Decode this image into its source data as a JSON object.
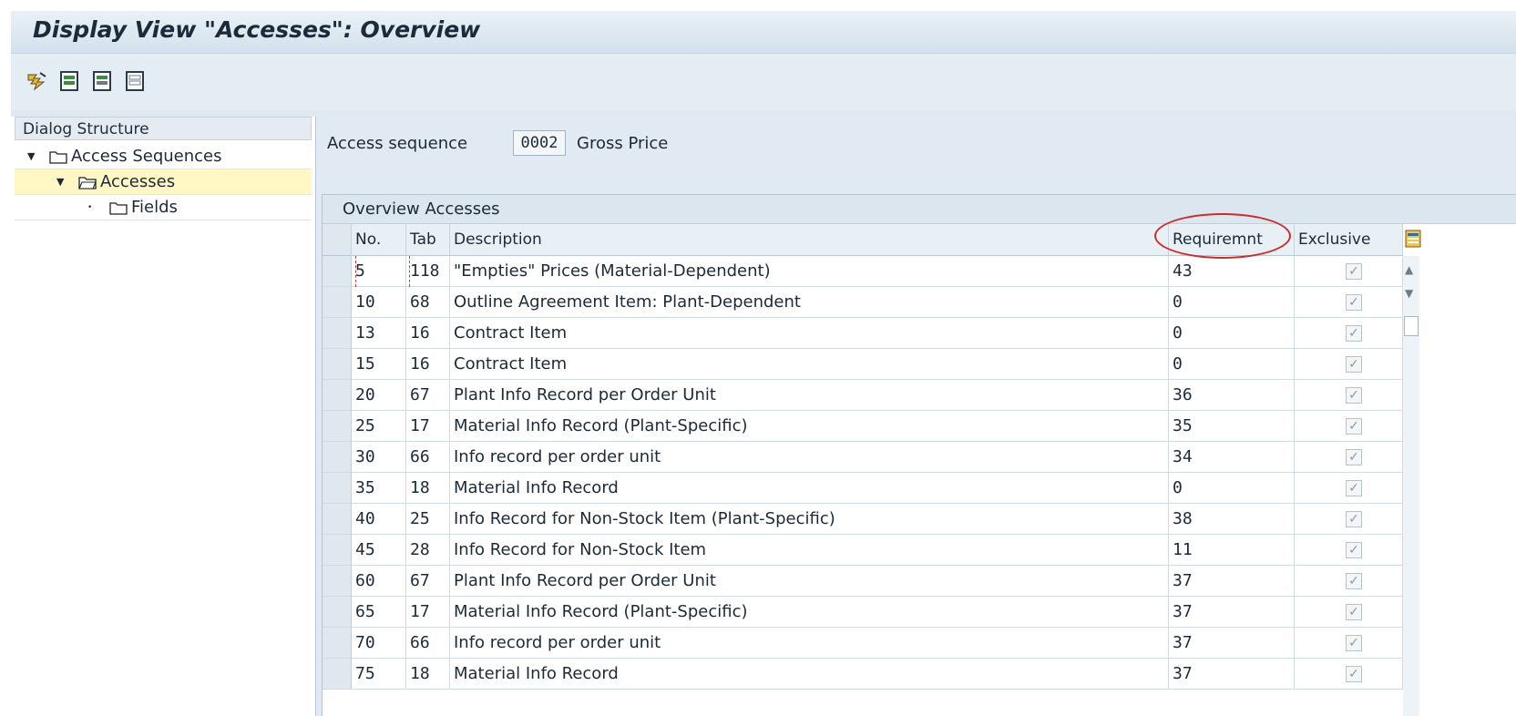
{
  "window": {
    "title": "Display View \"Accesses\": Overview"
  },
  "toolbar": {
    "icons": [
      "display-icon",
      "select-all-icon",
      "select-block-icon",
      "deselect-all-icon"
    ]
  },
  "dialog_structure": {
    "heading": "Dialog Structure",
    "items": [
      {
        "label": "Access Sequences"
      },
      {
        "label": "Accesses"
      },
      {
        "label": "Fields"
      }
    ]
  },
  "header": {
    "access_sequence_label": "Access sequence",
    "access_sequence_value": "0002",
    "access_sequence_desc": "Gross Price"
  },
  "table": {
    "title": "Overview Accesses",
    "columns": {
      "no": "No.",
      "tab": "Tab",
      "description": "Description",
      "requirement": "Requiremnt",
      "exclusive": "Exclusive"
    },
    "rows": [
      {
        "no": "5",
        "tab": "118",
        "description": "\"Empties\" Prices (Material-Dependent)",
        "requirement": "43",
        "exclusive": true
      },
      {
        "no": "10",
        "tab": "68",
        "description": "Outline Agreement Item: Plant-Dependent",
        "requirement": "0",
        "exclusive": true
      },
      {
        "no": "13",
        "tab": "16",
        "description": "Contract Item",
        "requirement": "0",
        "exclusive": true
      },
      {
        "no": "15",
        "tab": "16",
        "description": "Contract Item",
        "requirement": "0",
        "exclusive": true
      },
      {
        "no": "20",
        "tab": "67",
        "description": "Plant Info Record per Order Unit",
        "requirement": "36",
        "exclusive": true
      },
      {
        "no": "25",
        "tab": "17",
        "description": "Material Info Record (Plant-Specific)",
        "requirement": "35",
        "exclusive": true
      },
      {
        "no": "30",
        "tab": "66",
        "description": "Info record per order unit",
        "requirement": "34",
        "exclusive": true
      },
      {
        "no": "35",
        "tab": "18",
        "description": "Material Info Record",
        "requirement": "0",
        "exclusive": true
      },
      {
        "no": "40",
        "tab": "25",
        "description": "Info Record for Non-Stock Item (Plant-Specific)",
        "requirement": "38",
        "exclusive": true
      },
      {
        "no": "45",
        "tab": "28",
        "description": "Info Record for Non-Stock Item",
        "requirement": "11",
        "exclusive": true
      },
      {
        "no": "60",
        "tab": "67",
        "description": "Plant Info Record per Order Unit",
        "requirement": "37",
        "exclusive": true
      },
      {
        "no": "65",
        "tab": "17",
        "description": "Material Info Record (Plant-Specific)",
        "requirement": "37",
        "exclusive": true
      },
      {
        "no": "70",
        "tab": "66",
        "description": "Info record per order unit",
        "requirement": "37",
        "exclusive": true
      },
      {
        "no": "75",
        "tab": "18",
        "description": "Material Info Record",
        "requirement": "37",
        "exclusive": true
      }
    ]
  },
  "colors": {
    "selected_tree_item": "#fff7c4",
    "annotation_red": "#cc2b2b"
  }
}
